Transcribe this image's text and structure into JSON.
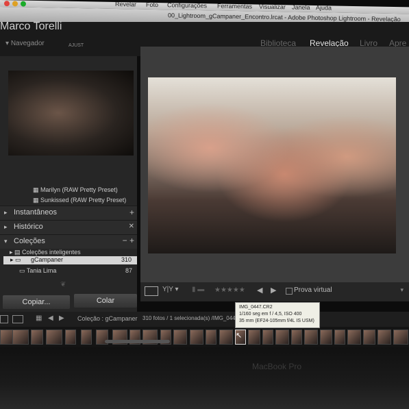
{
  "menubar": {
    "items": [
      "Revelar",
      "Foto",
      "Configurações",
      "Ferramentas",
      "Visualizar",
      "Janela",
      "Ajuda"
    ]
  },
  "window_title": "00_Lightroom_gCampaner_Encontro.lrcat - Adobe Photoshop Lightroom - Revelação",
  "identity_plate": "Marco Torelli",
  "modules": [
    "Biblioteca",
    "Revelação",
    "Livro",
    "Apre"
  ],
  "active_module": "Revelação",
  "navigator": {
    "title": "Navegador",
    "fit": "AJUST"
  },
  "presets": [
    "Marilyn (RAW Pretty Preset)",
    "Sunkissed (RAW Pretty Preset)"
  ],
  "panels": {
    "snapshots": "Instantâneos",
    "history": "Histórico",
    "collections": "Coleções"
  },
  "collections": [
    {
      "name": "Coleções inteligentes",
      "count": ""
    },
    {
      "name": "gCampaner",
      "count": "310"
    },
    {
      "name": "Tania Lima",
      "count": "87"
    }
  ],
  "buttons": {
    "copy": "Copiar...",
    "paste": "Colar"
  },
  "toolbar": {
    "soft_proof": "Prova virtual",
    "stars": "★★★★★"
  },
  "filmstrip": {
    "source": "Coleção : gCampaner",
    "status": "310 fotos / 1 selecionada(s) /IMG_0447"
  },
  "tooltip": {
    "file": "IMG_0447.CR2",
    "exposure": "1/160 seg em f / 4,5, ISO 400",
    "lens": "35 mm (EF24-105mm f/4L IS USM)"
  },
  "bezel": {
    "label": "MacBook Pro"
  }
}
